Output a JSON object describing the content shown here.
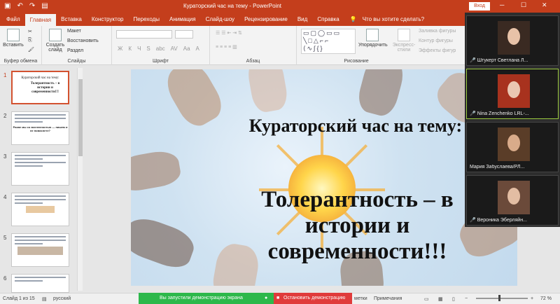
{
  "titlebar": {
    "title": "Кураторский час на тему  -  PowerPoint",
    "signin": "Вход",
    "qat": [
      "save-icon",
      "undo-icon",
      "redo-icon",
      "present-icon"
    ],
    "window_controls": [
      "─",
      "☐",
      "✕"
    ]
  },
  "tabs": [
    "Файл",
    "Главная",
    "Вставка",
    "Конструктор",
    "Переходы",
    "Анимация",
    "Слайд-шоу",
    "Рецензирование",
    "Вид",
    "Справка"
  ],
  "active_tab": "Главная",
  "tellme": "Что вы хотите сделать?",
  "ribbon": {
    "clipboard": {
      "paste": "Вставить",
      "label": "Буфер обмена"
    },
    "slides": {
      "new_slide": "Создать слайд",
      "layout": "Макет",
      "reset": "Восстановить",
      "section": "Раздел",
      "label": "Слайды"
    },
    "font": {
      "label": "Шрифт",
      "format_buttons": [
        "Ж",
        "К",
        "Ч",
        "S",
        "abc",
        "AV",
        "Aa",
        "A"
      ]
    },
    "paragraph": {
      "label": "Абзац"
    },
    "drawing": {
      "arrange": "Упорядочить",
      "quick_styles": "Экспресс-стили",
      "fill": "Заливка фигуры",
      "outline": "Контур фигуры",
      "effects": "Эффекты фигур",
      "label": "Рисование",
      "shape_rows": [
        "▭▢◯▭▭",
        "╲□△⌐⌐",
        "⟨∿∫{}"
      ]
    }
  },
  "thumbnails": [
    {
      "num": "1",
      "title": "Кураторский час на тему:",
      "subtitle": "Толерантность – в истории и современности!!!"
    },
    {
      "num": "2",
      "title": "",
      "subtitle": "Разве мы со вселенностью — пишем и не повиснете?"
    },
    {
      "num": "3",
      "title": "",
      "subtitle": ""
    },
    {
      "num": "4",
      "title": "",
      "subtitle": ""
    },
    {
      "num": "5",
      "title": "",
      "subtitle": ""
    },
    {
      "num": "6",
      "title": "",
      "subtitle": ""
    }
  ],
  "slide": {
    "title": "Кураторский час на тему:",
    "subtitle_lines": [
      "Толерантность – в",
      "истории и",
      "современности!!!"
    ]
  },
  "participants": [
    {
      "name": "Штукерт Светлана Л...",
      "active": false
    },
    {
      "name": "Nina Zenchenko LRL-...",
      "active": true
    },
    {
      "name": "Мария Забуслаева/РЛ...",
      "active": false
    },
    {
      "name": "Вероника Эберляйн...",
      "active": false
    }
  ],
  "statusbar": {
    "slide_info": "Слайд 1 из 15",
    "language": "русский",
    "notes_partial": "метки",
    "notes": "Примечания",
    "zoom": "72 %"
  },
  "share_banner": {
    "text": "Вы запустили демонстрацию экрана",
    "stop": "Остановить демонстрацию"
  },
  "colors": {
    "accent": "#c43e1c",
    "share": "#2db84b",
    "stop": "#e03b3b"
  }
}
